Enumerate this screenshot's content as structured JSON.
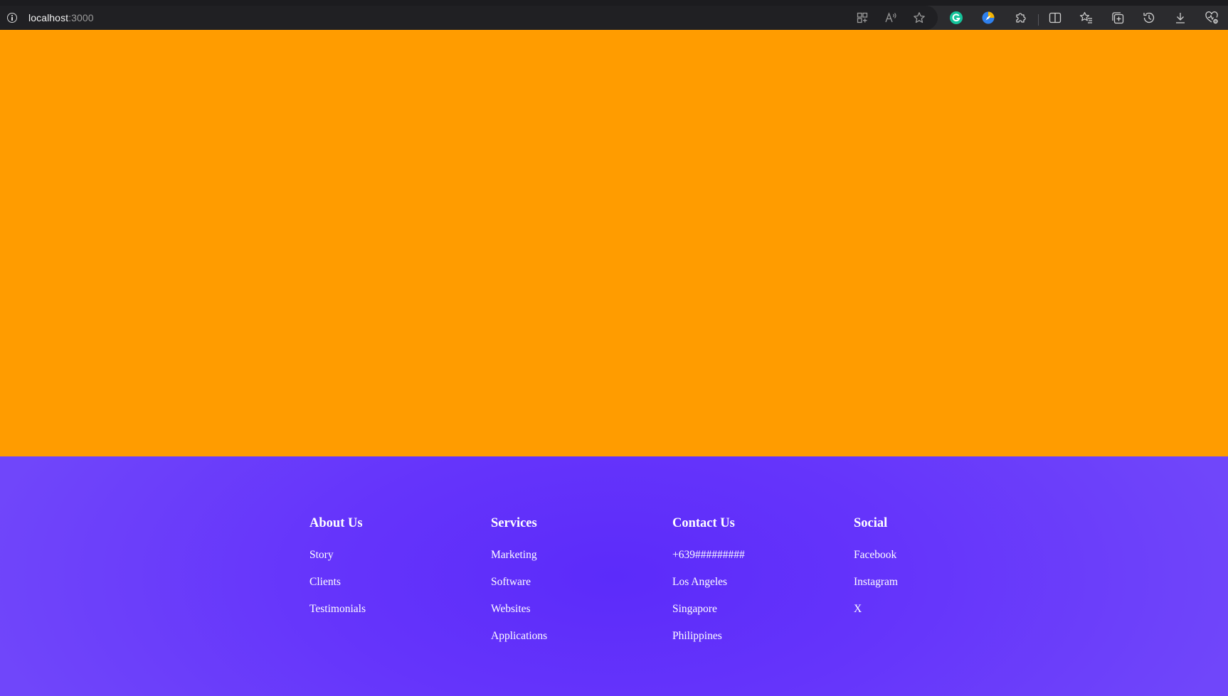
{
  "browser": {
    "url_host": "localhost",
    "url_port": ":3000",
    "toolbar_icons": [
      "info-icon",
      "app-available-icon",
      "read-aloud-icon",
      "favorite-star-icon",
      "grammarly-icon",
      "extension-compass-icon",
      "extensions-puzzle-icon",
      "split-screen-icon",
      "favorites-icon",
      "collections-icon",
      "history-icon",
      "downloads-icon",
      "browser-essentials-icon"
    ]
  },
  "hero": {
    "background": "#ff9c00"
  },
  "footer": {
    "background": "#6131fa",
    "columns": [
      {
        "title": "About Us",
        "items": [
          "Story",
          "Clients",
          "Testimonials"
        ]
      },
      {
        "title": "Services",
        "items": [
          "Marketing",
          "Software",
          "Websites",
          "Applications"
        ]
      },
      {
        "title": "Contact Us",
        "items": [
          "+639#########",
          "Los Angeles",
          "Singapore",
          "Philippines"
        ]
      },
      {
        "title": "Social",
        "items": [
          "Facebook",
          "Instagram",
          "X"
        ]
      }
    ]
  }
}
